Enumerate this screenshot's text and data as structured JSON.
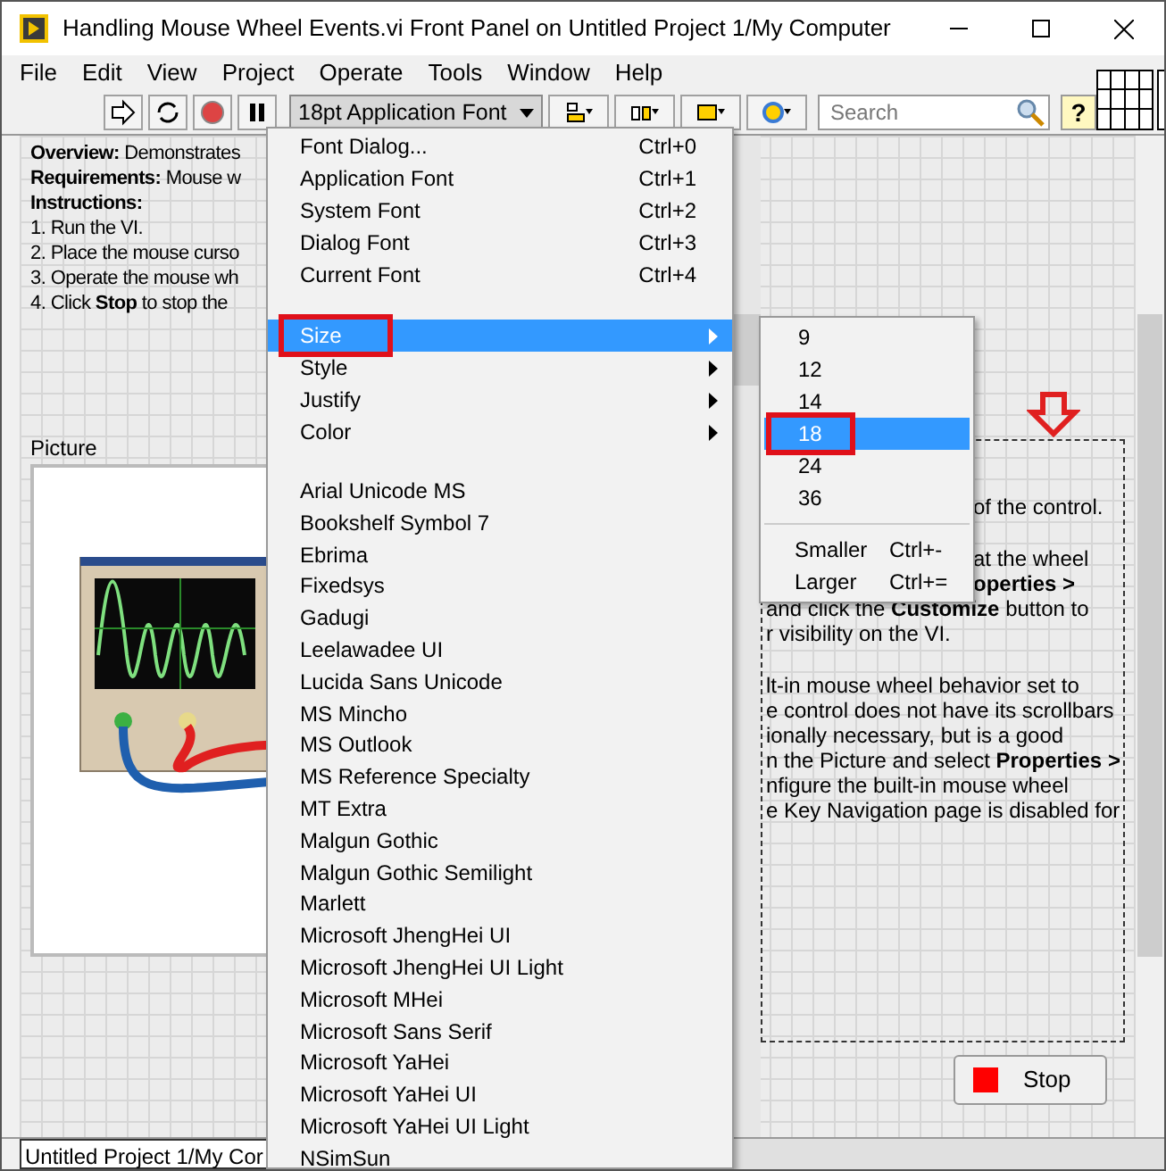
{
  "window": {
    "title": "Handling Mouse Wheel Events.vi Front Panel on Untitled Project 1/My Computer"
  },
  "menu_bar": [
    "File",
    "Edit",
    "View",
    "Project",
    "Operate",
    "Tools",
    "Window",
    "Help"
  ],
  "toolbar": {
    "font_dropdown": "18pt Application Font",
    "search": {
      "placeholder": "Search"
    },
    "help_button": "?"
  },
  "front_panel": {
    "instructions": [
      "**Overview:** Demonstrates",
      "**Requirements:** Mouse w",
      "**Instructions:**",
      "1. Run the VI.",
      "2. Place the mouse curso",
      "3. Operate the mouse wh",
      "4. Click **Stop** to stop the"
    ],
    "picture_label": "Picture",
    "description": [
      "of the control.",
      "at the wheel",
      "**operties >**",
      "and click the **Customize** button to",
      "r visibility on the VI.",
      "lt-in mouse wheel behavior set to",
      "e control does not have its scrollbars",
      "ionally necessary, but is a good",
      "n the Picture and select **Properties >**",
      "nfigure the built-in mouse wheel",
      "e Key Navigation page is disabled for"
    ],
    "stop_button": "Stop"
  },
  "status_bar": "Untitled Project 1/My Cor",
  "font_menu": {
    "commands": [
      {
        "label": "Font Dialog...",
        "shortcut": "Ctrl+0"
      },
      {
        "label": "Application Font",
        "shortcut": "Ctrl+1"
      },
      {
        "label": "System Font",
        "shortcut": "Ctrl+2"
      },
      {
        "label": "Dialog Font",
        "shortcut": "Ctrl+3"
      },
      {
        "label": "Current Font",
        "shortcut": "Ctrl+4"
      }
    ],
    "submenus": [
      {
        "label": "Size",
        "selected": true
      },
      {
        "label": "Style",
        "selected": false
      },
      {
        "label": "Justify",
        "selected": false
      },
      {
        "label": "Color",
        "selected": false
      }
    ],
    "fonts": [
      "Arial Unicode MS",
      "Bookshelf Symbol 7",
      "Ebrima",
      "Fixedsys",
      "Gadugi",
      "Leelawadee UI",
      "Lucida Sans Unicode",
      "MS Mincho",
      "MS Outlook",
      "MS Reference Specialty",
      "MT Extra",
      "Malgun Gothic",
      "Malgun Gothic Semilight",
      "Marlett",
      "Microsoft JhengHei UI",
      "Microsoft JhengHei UI Light",
      "Microsoft MHei",
      "Microsoft Sans Serif",
      "Microsoft YaHei",
      "Microsoft YaHei UI",
      "Microsoft YaHei UI Light",
      "NSimSun"
    ]
  },
  "size_submenu": {
    "sizes": [
      {
        "label": "9",
        "selected": false
      },
      {
        "label": "12",
        "selected": false
      },
      {
        "label": "14",
        "selected": false
      },
      {
        "label": "18",
        "selected": true
      },
      {
        "label": "24",
        "selected": false
      },
      {
        "label": "36",
        "selected": false
      }
    ],
    "commands": [
      {
        "label": "Smaller",
        "shortcut": "Ctrl+-"
      },
      {
        "label": "Larger",
        "shortcut": "Ctrl+="
      }
    ]
  }
}
